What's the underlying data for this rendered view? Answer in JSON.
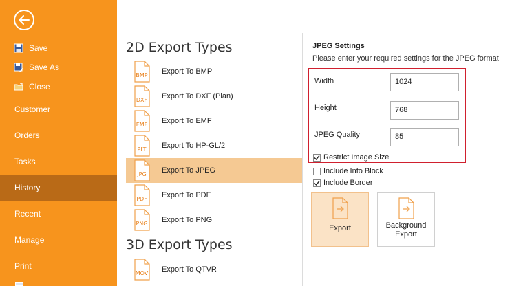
{
  "sidebar": {
    "file_items": [
      {
        "label": "Save",
        "icon": "floppy-disk-icon"
      },
      {
        "label": "Save As",
        "icon": "save-as-icon"
      },
      {
        "label": "Close",
        "icon": "folder-close-icon"
      }
    ],
    "nav_items": [
      {
        "label": "Customer"
      },
      {
        "label": "Orders"
      },
      {
        "label": "Tasks"
      },
      {
        "label": "History",
        "active": true
      },
      {
        "label": "Recent"
      },
      {
        "label": "Manage"
      },
      {
        "label": "Print"
      }
    ]
  },
  "export_types": {
    "section_2d": "2D Export Types",
    "items_2d": [
      {
        "ext": "BMP",
        "label": "Export To BMP"
      },
      {
        "ext": "DXF",
        "label": "Export To DXF (Plan)"
      },
      {
        "ext": "EMF",
        "label": "Export To EMF"
      },
      {
        "ext": "PLT",
        "label": "Export To HP-GL/2"
      },
      {
        "ext": "JPG",
        "label": "Export To JPEG",
        "selected": true
      },
      {
        "ext": "PDF",
        "label": "Export To PDF"
      },
      {
        "ext": "PNG",
        "label": "Export To PNG"
      }
    ],
    "section_3d": "3D Export Types",
    "items_3d": [
      {
        "ext": "MOV",
        "label": "Export To QTVR"
      }
    ]
  },
  "jpeg_settings": {
    "title": "JPEG Settings",
    "description": "Please enter your required settings for the JPEG format",
    "width_label": "Width",
    "width_value": "1024",
    "height_label": "Height",
    "height_value": "768",
    "quality_label": "JPEG Quality",
    "quality_value": "85",
    "restrict_label": "Restrict Image Size",
    "restrict_checked": true,
    "info_block_label": "Include Info Block",
    "info_block_checked": false,
    "border_label": "Include Border",
    "border_checked": true,
    "export_button": "Export",
    "background_export_button": "Background Export"
  },
  "colors": {
    "sidebar": "#f7941d",
    "sidebar_active": "#b96a17",
    "selected_item": "#f5c993",
    "highlight_box": "#d0202e"
  }
}
